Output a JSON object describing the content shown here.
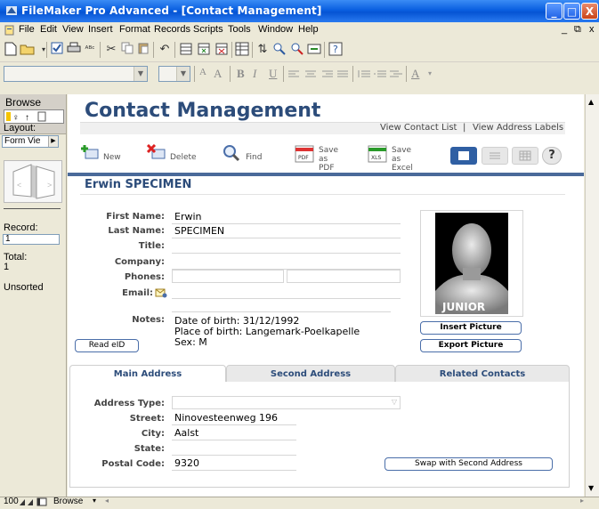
{
  "window": {
    "title": "FileMaker Pro Advanced - [Contact Management]",
    "minimize": "_",
    "maximize": "□",
    "close": "X",
    "child_minimize": "_",
    "child_restore": "⧉",
    "child_close": "x"
  },
  "menu": [
    "File",
    "Edit",
    "View",
    "Insert",
    "Format",
    "Records",
    "Scripts",
    "Tools",
    "Window",
    "Help"
  ],
  "format_toolbar": {
    "font_size_small": "A",
    "font_size_large": "A",
    "bold": "B",
    "italic": "I",
    "underline": "U",
    "text_color": "A"
  },
  "status": {
    "mode": "Browse",
    "layout_label": "Layout:",
    "layout_value": "Form Vie",
    "record_label": "Record:",
    "record_value": "1",
    "total_label": "Total:",
    "total_value": "1",
    "sort_state": "Unsorted"
  },
  "header": {
    "title": "Contact Management",
    "link_contact_list": "View Contact List",
    "separator": "|",
    "link_address_labels": "View Address Labels",
    "tools": {
      "new": "New",
      "delete": "Delete",
      "find": "Find",
      "save_pdf_1": "Save",
      "save_pdf_2": "as PDF",
      "save_excel_1": "Save",
      "save_excel_2": "as Excel",
      "help": "?"
    },
    "pdf_icon_text": "PDF",
    "xls_icon_text": "XLS"
  },
  "record": {
    "name_heading": "Erwin SPECIMEN",
    "labels": {
      "first_name": "First Name:",
      "last_name": "Last Name:",
      "title": "Title:",
      "company": "Company:",
      "phones": "Phones:",
      "email": "Email:",
      "notes": "Notes:"
    },
    "values": {
      "first_name": "Erwin",
      "last_name": "SPECIMEN",
      "title": "",
      "company": "",
      "notes_1": "Date of birth: 31/12/1992",
      "notes_2": "Place of birth: Langemark-Poelkapelle",
      "notes_3": "Sex: M"
    },
    "read_eid": "Read eID",
    "photo_caption": "JUNIOR",
    "insert_picture": "Insert Picture",
    "export_picture": "Export Picture"
  },
  "tabs": [
    {
      "label": "Main Address",
      "active": true
    },
    {
      "label": "Second Address",
      "active": false
    },
    {
      "label": "Related Contacts",
      "active": false
    }
  ],
  "address": {
    "labels": {
      "type": "Address Type:",
      "street": "Street:",
      "city": "City:",
      "state": "State:",
      "postal": "Postal Code:"
    },
    "values": {
      "type": "",
      "street": "Ninovesteenweg 196",
      "city": "Aalst",
      "state": "",
      "postal": "9320"
    },
    "swap_button": "Swap with Second Address"
  },
  "bottom": {
    "zoom": "100",
    "mode": "Browse"
  },
  "colors": {
    "accent": "#0a5fe0",
    "heading": "#2c4c7a",
    "view_button": "#2f5fa3"
  }
}
